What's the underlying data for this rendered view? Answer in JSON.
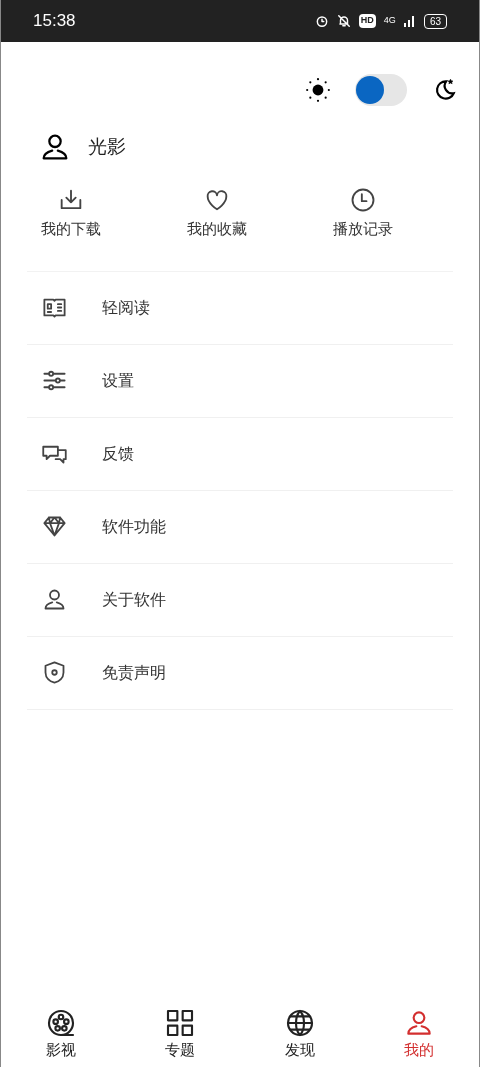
{
  "status_bar": {
    "time": "15:38",
    "hd": "HD",
    "network": "4G",
    "battery": "63"
  },
  "theme_toggle": {
    "on": false
  },
  "profile": {
    "name": "光影"
  },
  "shortcuts": [
    {
      "kind": "download",
      "label": "我的下载"
    },
    {
      "kind": "favorite",
      "label": "我的收藏"
    },
    {
      "kind": "history",
      "label": "播放记录"
    }
  ],
  "menu": [
    {
      "kind": "read",
      "label": "轻阅读"
    },
    {
      "kind": "settings",
      "label": "设置"
    },
    {
      "kind": "feedback",
      "label": "反馈"
    },
    {
      "kind": "features",
      "label": "软件功能"
    },
    {
      "kind": "about",
      "label": "关于软件"
    },
    {
      "kind": "disclaimer",
      "label": "免责声明"
    }
  ],
  "bottom_nav": [
    {
      "kind": "film",
      "label": "影视",
      "selected": false
    },
    {
      "kind": "grid",
      "label": "专题",
      "selected": false
    },
    {
      "kind": "globe",
      "label": "发现",
      "selected": false
    },
    {
      "kind": "user",
      "label": "我的",
      "selected": true
    }
  ]
}
